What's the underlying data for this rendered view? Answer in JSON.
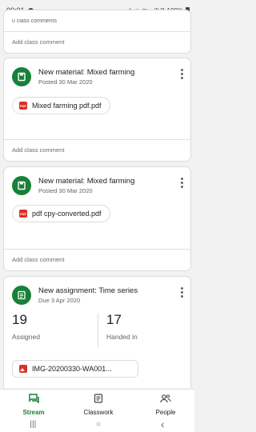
{
  "status_bar": {
    "time": "00:01",
    "icons_right": "⚠ ✶ ≋ ▴ ill ill",
    "battery": "100%"
  },
  "stream": {
    "top_card": {
      "partial_text": "0 class comments",
      "comment_placeholder": "Add class comment"
    },
    "cards": [
      {
        "type": "material",
        "title": "New material: Mixed farming",
        "date": "Posted 30 Mar 2020",
        "attachment": "Mixed farming pdf.pdf",
        "comment_placeholder": "Add class comment"
      },
      {
        "type": "material",
        "title": "New material: Mixed farming",
        "date": "Posted 30 Mar 2020",
        "attachment": "pdf cpy-converted.pdf",
        "comment_placeholder": "Add class comment"
      },
      {
        "type": "assignment",
        "title": "New assignment: Time series",
        "date": "Due 3 Apr 2020",
        "assigned_count": "19",
        "assigned_label": "Assigned",
        "handed_in_count": "17",
        "handed_in_label": "Handed in",
        "attachment": "IMG-20200330-WA001..."
      }
    ]
  },
  "bottom_nav": {
    "active_color": "#188038",
    "items": [
      {
        "label": "Stream",
        "icon": "stream-icon"
      },
      {
        "label": "Classwork",
        "icon": "classwork-icon"
      },
      {
        "label": "People",
        "icon": "people-icon"
      }
    ]
  },
  "system_nav": {
    "recents": "|||",
    "home": "○",
    "back": "‹"
  }
}
